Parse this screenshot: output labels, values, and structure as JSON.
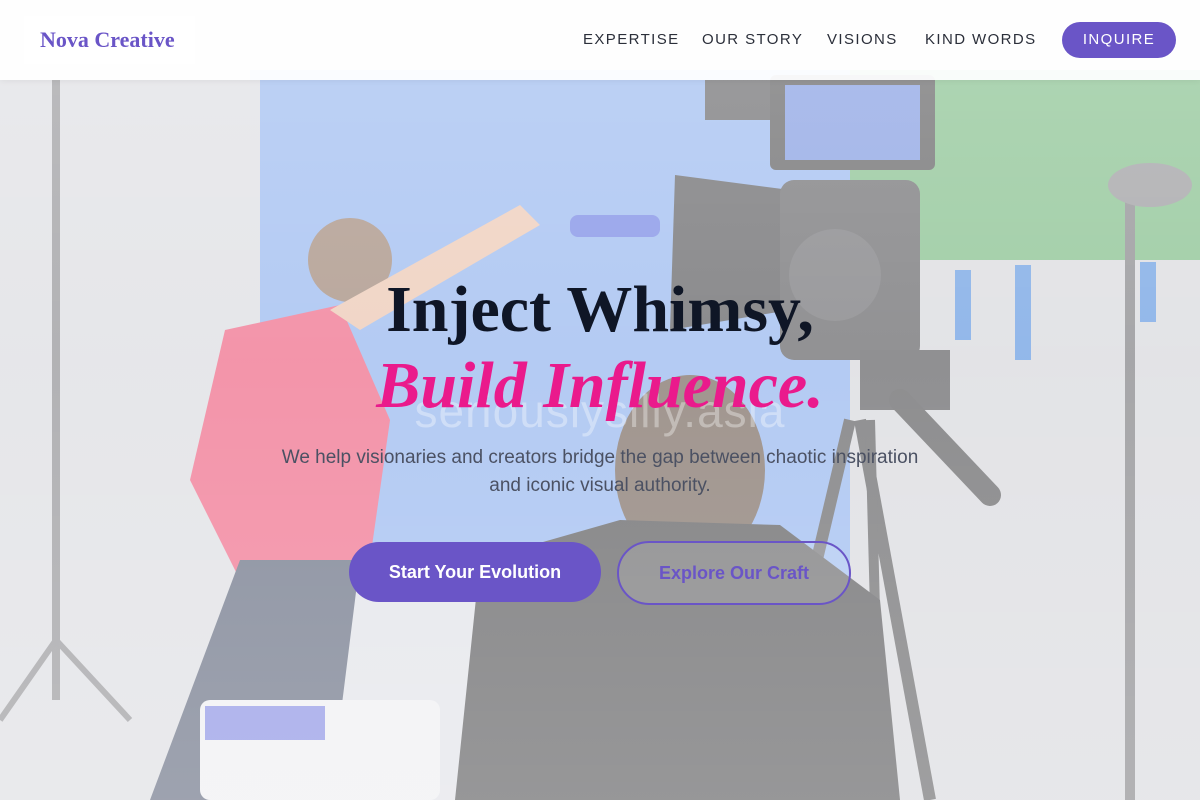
{
  "header": {
    "logo": "Nova Creative",
    "nav": [
      {
        "label": "EXPERTISE"
      },
      {
        "label": "OUR STORY"
      },
      {
        "label": "VISIONS"
      },
      {
        "label": "KIND WORDS"
      }
    ],
    "cta_label": "INQUIRE"
  },
  "hero": {
    "headline_line1": "Inject Whimsy,",
    "headline_line2": "Build Influence.",
    "subtitle": "We help visionaries and creators bridge the gap between chaotic inspiration and iconic visual authority.",
    "primary_button": "Start Your Evolution",
    "secondary_button": "Explore Our Craft",
    "watermark": "seriouslysilly.asia"
  },
  "colors": {
    "accent": "#6a55c7",
    "highlight": "#ea1a8c",
    "headline": "#0f1626",
    "body_text": "#4b5163"
  },
  "background": {
    "description_icon": "film-set-photo"
  }
}
